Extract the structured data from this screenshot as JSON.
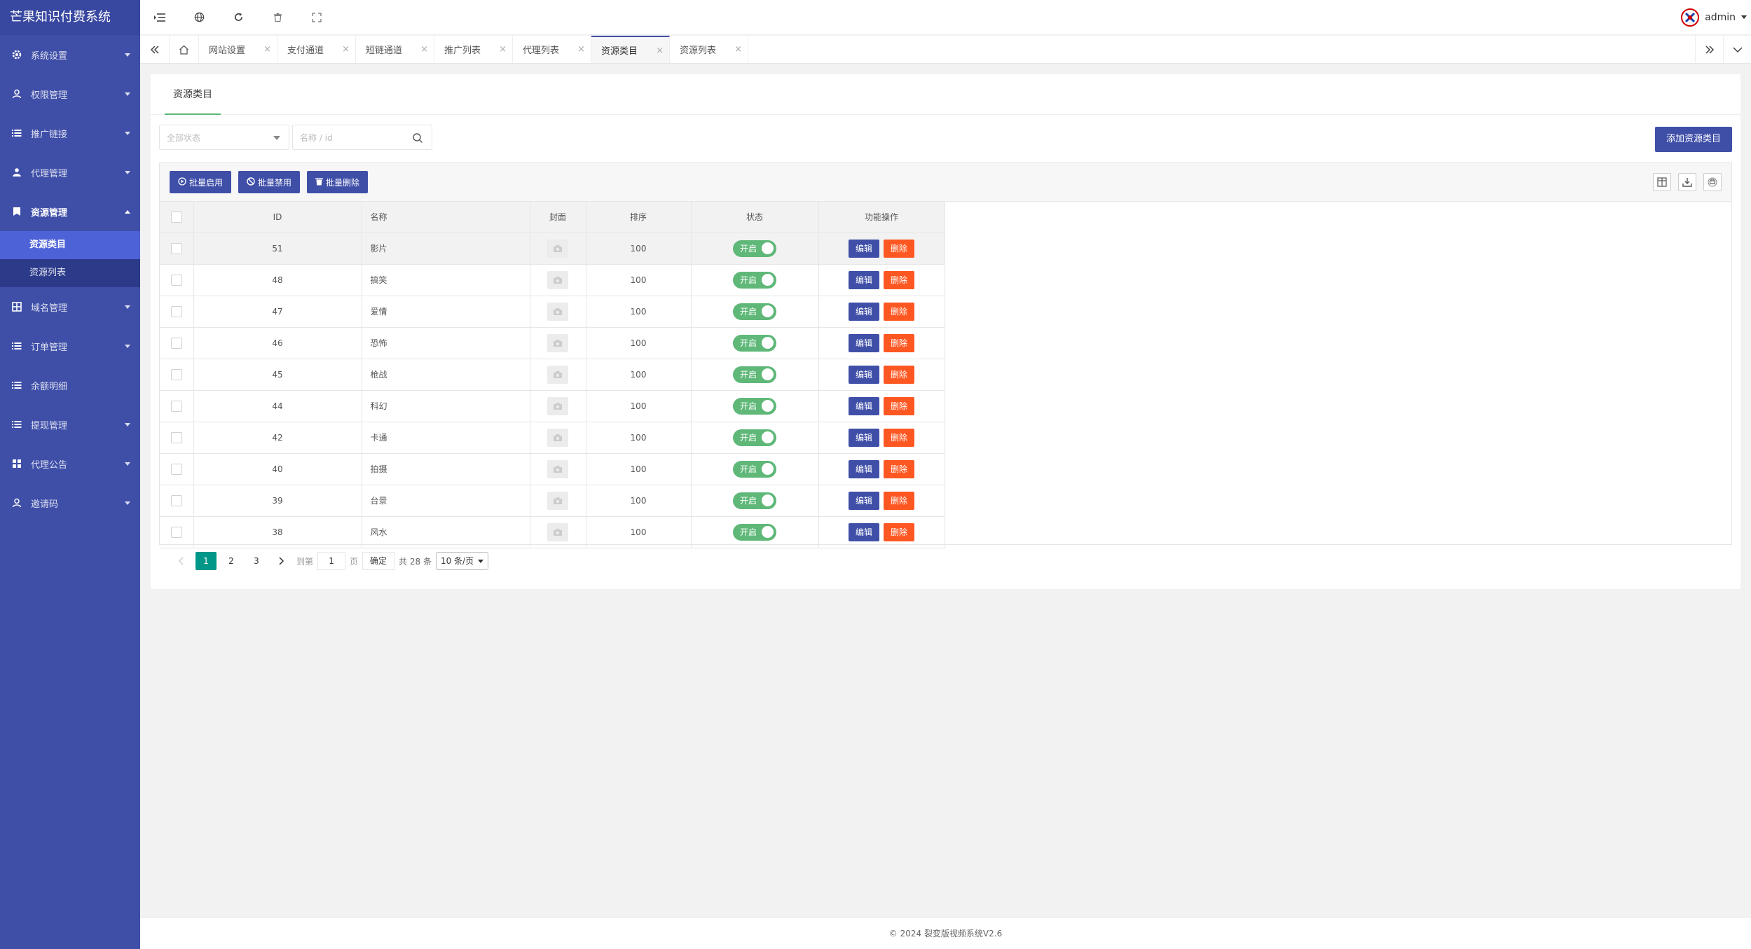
{
  "brand": "芒果知识付费系统",
  "sidebar": {
    "items": [
      {
        "label": "系统设置",
        "icon": "gear-icon"
      },
      {
        "label": "权限管理",
        "icon": "user-icon"
      },
      {
        "label": "推广链接",
        "icon": "list-icon"
      },
      {
        "label": "代理管理",
        "icon": "users-icon"
      },
      {
        "label": "资源管理",
        "icon": "bookmark-icon"
      },
      {
        "label": "域名管理",
        "icon": "grid-icon"
      },
      {
        "label": "订单管理",
        "icon": "list-icon"
      },
      {
        "label": "余额明细",
        "icon": "list-icon"
      },
      {
        "label": "提现管理",
        "icon": "list-icon"
      },
      {
        "label": "代理公告",
        "icon": "apps-icon"
      },
      {
        "label": "邀请码",
        "icon": "user-icon"
      }
    ],
    "sub_items": [
      {
        "label": "资源类目",
        "active": true
      },
      {
        "label": "资源列表",
        "active": false
      }
    ]
  },
  "header": {
    "user": "admin"
  },
  "tabs": [
    {
      "label": "网站设置"
    },
    {
      "label": "支付通道"
    },
    {
      "label": "短链通道"
    },
    {
      "label": "推广列表"
    },
    {
      "label": "代理列表"
    },
    {
      "label": "资源类目",
      "active": true
    },
    {
      "label": "资源列表"
    }
  ],
  "tab_close": "×",
  "card": {
    "tab_title": "资源类目",
    "filter_status_placeholder": "全部状态",
    "search_placeholder": "名称 / id",
    "add_button": "添加资源类目"
  },
  "toolbar": {
    "enable_label": "批量启用",
    "disable_label": "批量禁用",
    "delete_label": "批量删除"
  },
  "table": {
    "headers": {
      "id": "ID",
      "name": "名称",
      "cover": "封面",
      "sort": "排序",
      "status": "状态",
      "actions": "功能操作"
    },
    "edit_label": "编辑",
    "delete_label": "删除",
    "status_on": "开启",
    "rows": [
      {
        "id": "51",
        "name": "影片",
        "sort": "100"
      },
      {
        "id": "48",
        "name": "搞笑",
        "sort": "100"
      },
      {
        "id": "47",
        "name": "爱情",
        "sort": "100"
      },
      {
        "id": "46",
        "name": "恐怖",
        "sort": "100"
      },
      {
        "id": "45",
        "name": "枪战",
        "sort": "100"
      },
      {
        "id": "44",
        "name": "科幻",
        "sort": "100"
      },
      {
        "id": "42",
        "name": "卡通",
        "sort": "100"
      },
      {
        "id": "40",
        "name": "拍摄",
        "sort": "100"
      },
      {
        "id": "39",
        "name": "台景",
        "sort": "100"
      },
      {
        "id": "38",
        "name": "风水",
        "sort": "100"
      }
    ]
  },
  "pager": {
    "pages": [
      "1",
      "2",
      "3"
    ],
    "current": "1",
    "goto_label": "到第",
    "goto_value": "1",
    "page_unit": "页",
    "confirm": "确定",
    "total": "共 28 条",
    "size": "10 条/页"
  },
  "footer": "© 2024 裂变版视频系统V2.6",
  "colors": {
    "primary": "#3f4fa8",
    "success": "#5fb878",
    "danger": "#ff5722",
    "pager_active": "#009688"
  }
}
